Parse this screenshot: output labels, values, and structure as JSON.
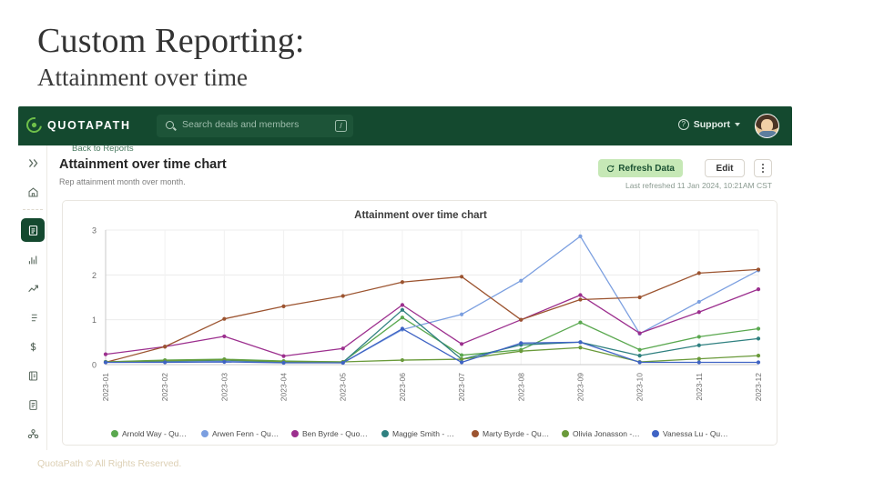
{
  "slide": {
    "title": "Custom Reporting:",
    "subtitle": "Attainment over time",
    "footer": "QuotaPath © All Rights Reserved."
  },
  "appbar": {
    "logo_text": "QUOTAPATH",
    "search_placeholder": "Search deals and members",
    "search_value": "",
    "search_shortcut": "/",
    "support_label": "Support"
  },
  "sidebar": {
    "items": [
      {
        "name": "expand-rail",
        "icon": "chevrons-right-icon",
        "active": false
      },
      {
        "name": "home",
        "icon": "home-icon",
        "active": false
      },
      {
        "name": "reports",
        "icon": "report-icon",
        "active": true
      },
      {
        "name": "dashboards",
        "icon": "bar-chart-icon",
        "active": false
      },
      {
        "name": "forecasting",
        "icon": "trending-up-icon",
        "active": false
      },
      {
        "name": "plans",
        "icon": "list-icon",
        "active": false
      },
      {
        "name": "earnings",
        "icon": "dollar-icon",
        "active": false
      },
      {
        "name": "ledger",
        "icon": "book-icon",
        "active": false
      },
      {
        "name": "documents",
        "icon": "document-icon",
        "active": false
      },
      {
        "name": "team",
        "icon": "people-icon",
        "active": false
      }
    ]
  },
  "page": {
    "breadcrumb": "Back to Reports",
    "title": "Attainment over time chart",
    "subtitle": "Rep attainment month over month.",
    "refresh_label": "Refresh Data",
    "edit_label": "Edit",
    "last_refreshed": "Last refreshed 11 Jan 2024, 10:21AM CST"
  },
  "chart_data": {
    "type": "line",
    "title": "Attainment over time chart",
    "xlabel": "",
    "ylabel": "",
    "ylim": [
      0,
      3
    ],
    "yticks": [
      0,
      1,
      2,
      3
    ],
    "grid": true,
    "legend_position": "bottom",
    "categories": [
      "2023-01",
      "2023-02",
      "2023-03",
      "2023-04",
      "2023-05",
      "2023-06",
      "2023-07",
      "2023-08",
      "2023-09",
      "2023-10",
      "2023-11",
      "2023-12"
    ],
    "series": [
      {
        "name": "Arnold Way - Quota...",
        "color": "#5aa84f",
        "values": [
          0.06,
          0.1,
          0.12,
          0.08,
          0.06,
          1.05,
          0.21,
          0.33,
          0.94,
          0.33,
          0.62,
          0.8
        ]
      },
      {
        "name": "Arwen Fenn - Quota...",
        "color": "#7b9fe0",
        "values": [
          0.05,
          0.06,
          0.07,
          0.05,
          0.04,
          0.78,
          1.12,
          1.87,
          2.86,
          0.69,
          1.4,
          2.1
        ]
      },
      {
        "name": "Ben Byrde - Quota ...",
        "color": "#9c2f8e",
        "values": [
          0.23,
          0.4,
          0.63,
          0.19,
          0.36,
          1.33,
          0.46,
          1.0,
          1.55,
          0.7,
          1.17,
          1.68
        ]
      },
      {
        "name": "Maggie Smith - Quo...",
        "color": "#2f8080",
        "values": [
          0.06,
          0.08,
          0.1,
          0.06,
          0.05,
          1.22,
          0.12,
          0.44,
          0.5,
          0.2,
          0.43,
          0.58
        ]
      },
      {
        "name": "Marty Byrde - Quot...",
        "color": "#9c5430",
        "values": [
          0.05,
          0.4,
          1.02,
          1.3,
          1.53,
          1.84,
          1.96,
          1.0,
          1.45,
          1.5,
          2.04,
          2.12
        ]
      },
      {
        "name": "Olivia Jonasson - ...",
        "color": "#6a9a3a",
        "values": [
          0.06,
          0.09,
          0.11,
          0.07,
          0.06,
          0.1,
          0.12,
          0.3,
          0.38,
          0.06,
          0.13,
          0.2
        ]
      },
      {
        "name": "Vanessa Lu - Quota...",
        "color": "#3f63c4",
        "values": [
          0.05,
          0.05,
          0.06,
          0.04,
          0.04,
          0.8,
          0.05,
          0.48,
          0.5,
          0.05,
          0.05,
          0.05
        ]
      }
    ]
  }
}
